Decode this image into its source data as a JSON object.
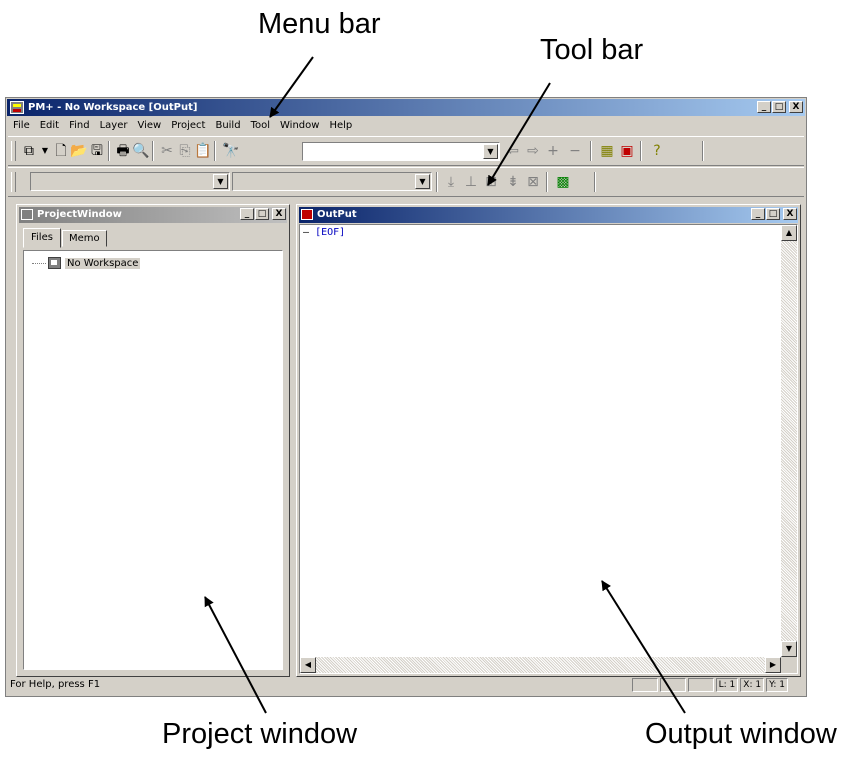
{
  "annotations": {
    "menu_bar": "Menu bar",
    "tool_bar": "Tool bar",
    "project_window": "Project window",
    "output_window": "Output window"
  },
  "app": {
    "title": "PM+ - No Workspace  [OutPut]",
    "window_buttons": {
      "minimize": "_",
      "maximize": "□",
      "close": "X"
    }
  },
  "menu": [
    "File",
    "Edit",
    "Find",
    "Layer",
    "View",
    "Project",
    "Build",
    "Tool",
    "Window",
    "Help"
  ],
  "toolbar": {
    "icons": [
      "new-workspace-icon",
      "dropdown-icon",
      "new-file-icon",
      "open-folder-icon",
      "save-icon",
      "print-icon",
      "print-preview-icon",
      "cut-icon",
      "copy-icon",
      "paste-icon",
      "find-icon",
      "back-icon",
      "forward-icon",
      "add-icon",
      "remove-icon",
      "project-window-icon",
      "output-window-icon",
      "help-icon"
    ],
    "search_value": "",
    "build_combo_1": "",
    "build_combo_2": ""
  },
  "project_window": {
    "title": "ProjectWindow",
    "tabs": [
      "Files",
      "Memo"
    ],
    "active_tab": "Files",
    "tree": [
      {
        "label": "No Workspace"
      }
    ]
  },
  "output_window": {
    "title": "OutPut",
    "lines": [
      {
        "prefix": "–",
        "text": "[EOF]"
      }
    ]
  },
  "status": {
    "help_text": "For Help, press F1",
    "line": "L: 1",
    "x": "X: 1",
    "y": "Y: 1"
  },
  "colors": {
    "titlebar_active": "#0a246a",
    "titlebar_inactive": "#808080",
    "eof_text": "#0000c0",
    "window_bg": "#d4d0c8"
  }
}
